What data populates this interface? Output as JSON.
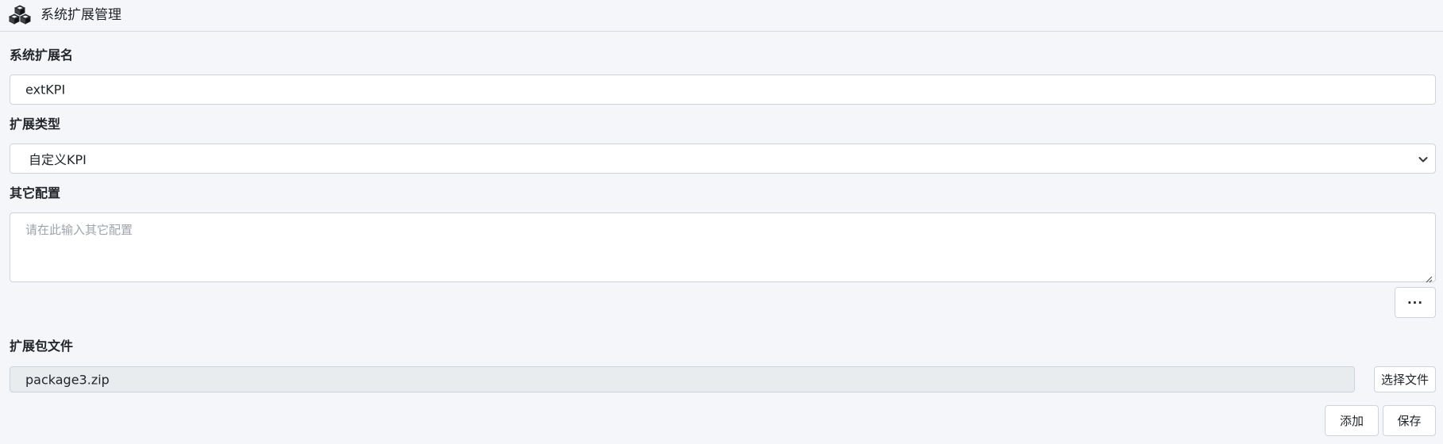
{
  "header": {
    "title": "系统扩展管理",
    "icon": "cubes-icon"
  },
  "form": {
    "name": {
      "label": "系统扩展名",
      "value": "extKPI"
    },
    "type": {
      "label": "扩展类型",
      "selected": "自定义KPI"
    },
    "other_config": {
      "label": "其它配置",
      "placeholder": "请在此输入其它配置"
    },
    "more_button": "···",
    "package_file": {
      "label": "扩展包文件",
      "value": "package3.zip",
      "choose_button": "选择文件"
    },
    "add_button": "添加",
    "save_button": "保存"
  }
}
